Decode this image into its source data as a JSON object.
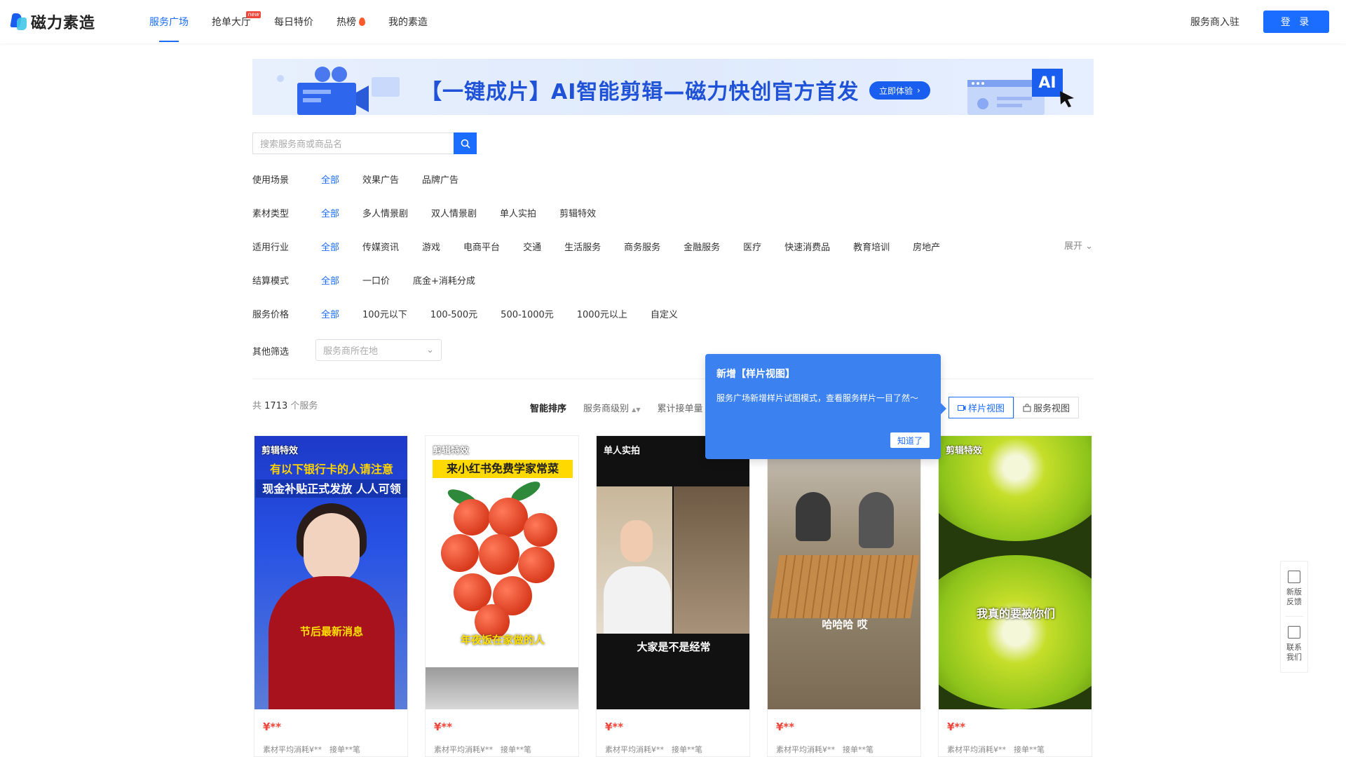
{
  "nav": {
    "logo_text": "磁力素造",
    "links": [
      {
        "label": "服务广场",
        "active": true
      },
      {
        "label": "抢单大厅",
        "badge": "new"
      },
      {
        "label": "每日特价"
      },
      {
        "label": "热榜"
      },
      {
        "label": "我的素造"
      }
    ],
    "settle_label": "服务商入驻",
    "login_label": "登 录"
  },
  "banner": {
    "title": "【一键成片】AI智能剪辑—磁力快创官方首发",
    "cta": "立即体验",
    "cta_arrow": "›",
    "ai_label": "AI"
  },
  "search": {
    "placeholder": "搜索服务商或商品名"
  },
  "filters": {
    "scene": {
      "label": "使用场景",
      "options": [
        "全部",
        "效果广告",
        "品牌广告"
      ]
    },
    "material": {
      "label": "素材类型",
      "options": [
        "全部",
        "多人情景剧",
        "双人情景剧",
        "单人实拍",
        "剪辑特效"
      ]
    },
    "industry": {
      "label": "适用行业",
      "options": [
        "全部",
        "传媒资讯",
        "游戏",
        "电商平台",
        "交通",
        "生活服务",
        "商务服务",
        "金融服务",
        "医疗",
        "快速消费品",
        "教育培训",
        "房地产"
      ]
    },
    "settlement": {
      "label": "结算模式",
      "options": [
        "全部",
        "一口价",
        "底金+消耗分成"
      ]
    },
    "price": {
      "label": "服务价格",
      "options": [
        "全部",
        "100元以下",
        "100-500元",
        "500-1000元",
        "1000元以上",
        "自定义"
      ]
    },
    "other": {
      "label": "其他筛选",
      "location_placeholder": "服务商所在地"
    },
    "expand_label": "展开"
  },
  "results": {
    "total_prefix": "共",
    "total_count": "1713",
    "total_suffix": "个服务",
    "sort": [
      "智能排序",
      "服务商级别",
      "累计接单量"
    ],
    "sort_arrows": "▲▼",
    "view_sample": "样片视图",
    "view_service": "服务视图"
  },
  "popup": {
    "title": "新增【样片视图】",
    "body": "服务广场新增样片试图模式，查看服务样片一目了然～",
    "button": "知道了"
  },
  "cards": [
    {
      "tag": "剪辑特效",
      "price": "¥**",
      "meta": "素材平均消耗¥**　接单**笔",
      "line1": "有以下银行卡的人请注意",
      "line2": "现金补贴正式发放 人人可领",
      "sub": "节后最新消息"
    },
    {
      "tag": "剪辑特效",
      "price": "¥**",
      "meta": "素材平均消耗¥**　接单**笔",
      "line1": "来小红书免费学家常菜",
      "sub": "年夜饭在家做的人"
    },
    {
      "tag": "单人实拍",
      "price": "¥**",
      "meta": "素材平均消耗¥**　接单**笔",
      "sub": "大家是不是经常"
    },
    {
      "tag": "",
      "price": "¥**",
      "meta": "素材平均消耗¥**　接单**笔",
      "sub": "哈哈哈 哎"
    },
    {
      "tag": "剪辑特效",
      "price": "¥**",
      "meta": "素材平均消耗¥**　接单**笔",
      "sub": "我真的要被你们"
    }
  ],
  "side": {
    "feedback": "新版反馈",
    "contact": "联系我们"
  },
  "colors": {
    "accent": "#1a6dff",
    "price": "#f0453a",
    "popup": "#3b82f0"
  }
}
